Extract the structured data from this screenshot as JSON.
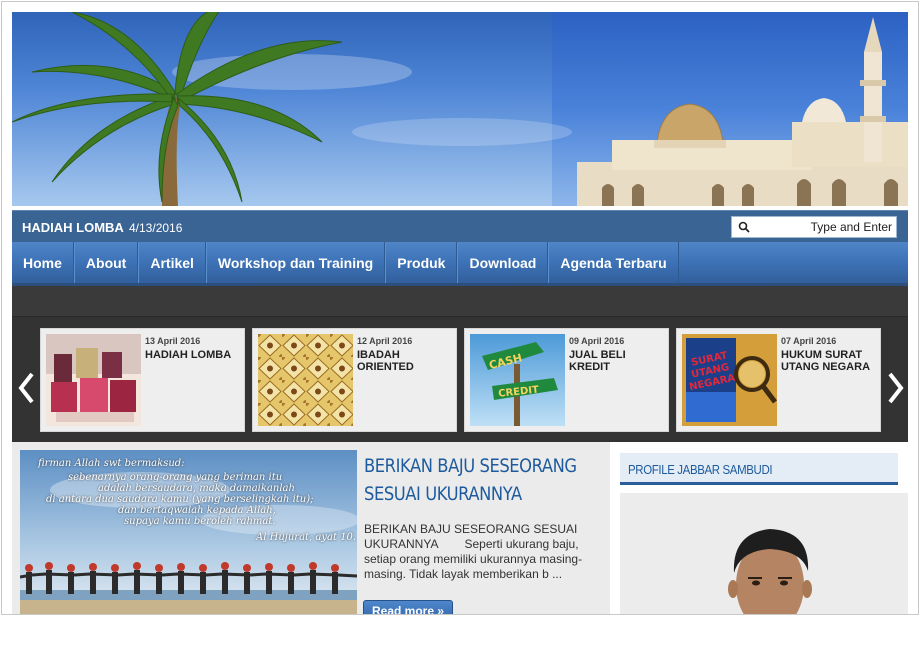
{
  "header": {
    "site_title": "HADIAH LOMBA",
    "date": "4/13/2016",
    "search_placeholder": "Type and Enter"
  },
  "nav": {
    "items": [
      "Home",
      "About",
      "Artikel",
      "Workshop dan Training",
      "Produk",
      "Download",
      "Agenda Terbaru"
    ]
  },
  "carousel": {
    "cards": [
      {
        "date": "13 April 2016",
        "title": "HADIAH LOMBA"
      },
      {
        "date": "12 April 2016",
        "title": "IBADAH ORIENTED"
      },
      {
        "date": "09 April 2016",
        "title": "JUAL BELI KREDIT"
      },
      {
        "date": "07 April 2016",
        "title": "HUKUM SURAT UTANG NEGARA"
      }
    ]
  },
  "post": {
    "title": "BERIKAN BAJU SESEORANG SESUAI UKURANNYA",
    "excerpt": "BERIKAN BAJU SESEORANG SESUAI UKURANNYA        Seperti ukurang baju, setiap orang memiliki ukurannya masing-masing. Tidak layak memberikan b ...",
    "read_more": "Read more »",
    "image_caption": {
      "intro": "firman Allah swt bermaksud:",
      "line1": "sebenarnya orang-orang yang beriman itu",
      "line2": "adalah bersaudara, maka damaikanlah",
      "line3": "di antara dua saudara kamu (yang berselingkah itu);",
      "line4": "dan bertaqwalah kepada Allah,",
      "line5": "supaya kamu beroleh rahmat.",
      "ref": "Al Hujurat, ayat 10."
    }
  },
  "sidebar": {
    "widget_title": "PROFILE JABBAR SAMBUDI"
  },
  "thumb_text": {
    "cash": "CASH",
    "credit": "CREDIT",
    "book_title_1": "SURAT",
    "book_title_2": "UTANG",
    "book_title_3": "NEGARA"
  },
  "colors": {
    "nav_blue": "#3d72b6",
    "title_blue": "#1d5b9e",
    "dark_strip": "#333333"
  }
}
